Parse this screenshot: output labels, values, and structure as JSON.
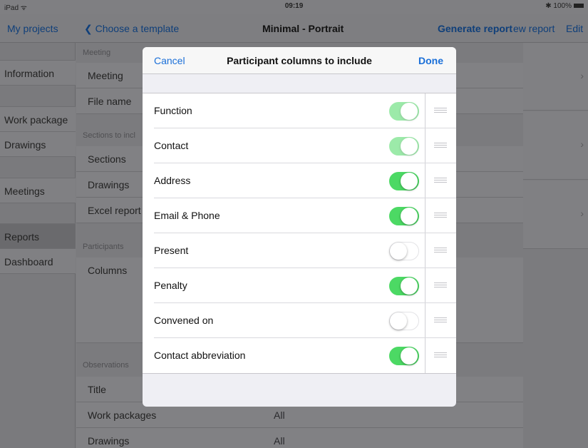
{
  "status_bar": {
    "carrier": "iPad ᯤ",
    "time": "09:19",
    "battery": "✱ 100%"
  },
  "nav": {
    "left": "My projects",
    "back": "Choose a template",
    "title": "Minimal - Portrait",
    "generate": "Generate report",
    "view": "ew report",
    "edit": "Edit"
  },
  "sidebar": {
    "items": [
      {
        "label": "Information"
      },
      {
        "label": "Work package"
      },
      {
        "label": "Drawings"
      },
      {
        "label": "Meetings"
      },
      {
        "label": "Reports",
        "selected": true
      },
      {
        "label": "Dashboard"
      }
    ]
  },
  "middle": {
    "sections": {
      "meeting": "Meeting",
      "sections_to_include": "Sections to incl",
      "participants": "Participants",
      "observations": "Observations"
    },
    "rows": {
      "meeting": "Meeting",
      "file_name": "File name",
      "sections": "Sections",
      "drawings": "Drawings",
      "excel_report": "Excel report",
      "columns": "Columns",
      "title": "Title",
      "work_packages": "Work packages",
      "work_packages_value": "All",
      "drawings_bottom": "Drawings",
      "drawings_bottom_value": "All"
    }
  },
  "modal": {
    "cancel": "Cancel",
    "title": "Participant columns to include",
    "done": "Done",
    "rows": [
      {
        "label": "Function",
        "on": true,
        "disabled": true
      },
      {
        "label": "Contact",
        "on": true,
        "disabled": true
      },
      {
        "label": "Address",
        "on": true,
        "disabled": false
      },
      {
        "label": "Email & Phone",
        "on": true,
        "disabled": false
      },
      {
        "label": "Present",
        "on": false,
        "disabled": false
      },
      {
        "label": "Penalty",
        "on": true,
        "disabled": false
      },
      {
        "label": "Convened on",
        "on": false,
        "disabled": false
      },
      {
        "label": "Contact abbreviation",
        "on": true,
        "disabled": false
      }
    ]
  },
  "colors": {
    "accent": "#1a6fd8",
    "toggle_on": "#4cd964"
  }
}
